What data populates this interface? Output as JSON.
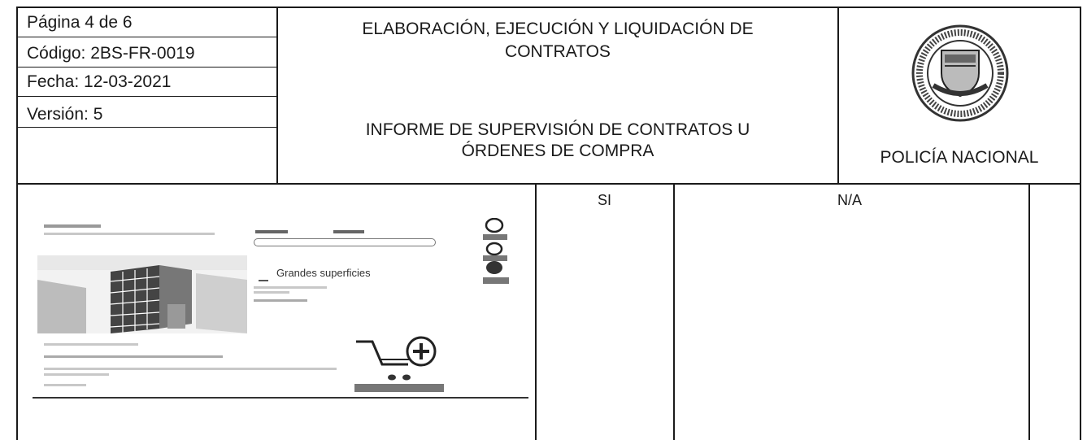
{
  "header": {
    "page_label": "Página 4 de 6",
    "code_label": "Código: 2BS-FR-0019",
    "date_label": "Fecha:  12-03-2021",
    "version_label": "Versión: 5",
    "title_line1": "ELABORACIÓN, EJECUCIÓN Y LIQUIDACIÓN DE",
    "title_line2": "CONTRATOS",
    "subtitle_line1": "INFORME DE SUPERVISIÓN DE CONTRATOS U",
    "subtitle_line2": "ÓRDENES DE COMPRA",
    "org_name": "POLICÍA NACIONAL"
  },
  "table": {
    "col_si": "SI",
    "col_na": "N/A"
  },
  "thumbnail": {
    "heading": "Grandes superficies"
  }
}
